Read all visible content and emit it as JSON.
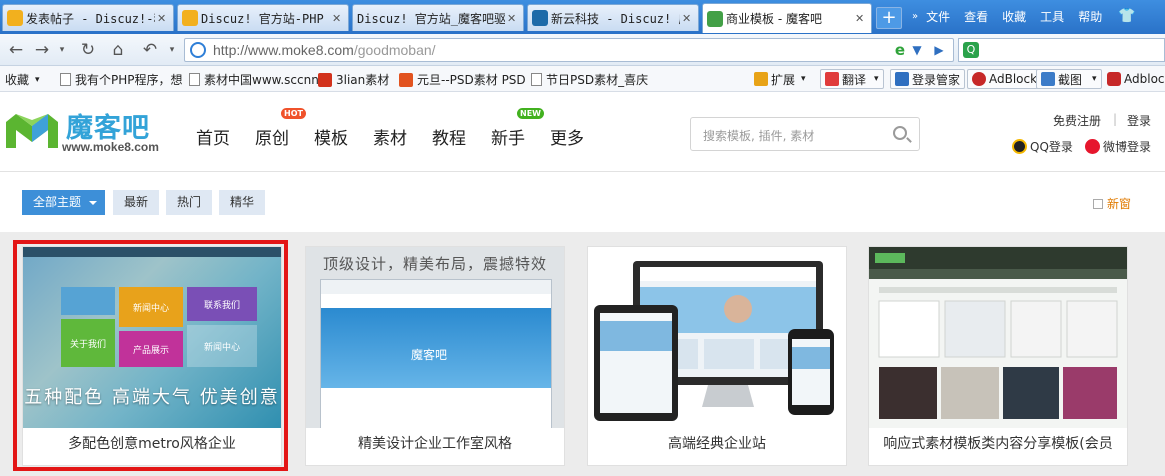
{
  "browser": {
    "tabs": [
      {
        "title": "发表帖子 - Discuz!-移",
        "close": "✕",
        "color": "#f2b01e"
      },
      {
        "title": "Discuz! 官方站-PHP 开",
        "close": "✕",
        "color": "#f2b01e"
      },
      {
        "title": "Discuz! 官方站_魔客吧驱",
        "close": "✕",
        "color": "#2b84d6"
      },
      {
        "title": "新云科技 - Discuz! 应",
        "close": "✕",
        "color": "#1d6aa8"
      },
      {
        "title": "商业模板 - 魔客吧",
        "close": "✕",
        "color": "#43a047"
      }
    ],
    "new_tab": "+",
    "menu": [
      "文件",
      "查看",
      "收藏",
      "工具",
      "帮助"
    ],
    "url_host": "http://www.moke8.com",
    "url_path": "/goodmoban/",
    "bookmarks": [
      {
        "label": "收藏",
        "icon": "chevron-down-icon"
      },
      {
        "label": "我有个PHP程序，想",
        "icon": "page-icon"
      },
      {
        "label": "素材中国www.sccnn",
        "icon": "page-icon"
      },
      {
        "label": "3lian素材",
        "icon": "3lian-icon"
      },
      {
        "label": "元旦--PSD素材 PSD",
        "icon": "psd-icon"
      },
      {
        "label": "节日PSD素材_喜庆",
        "icon": "page-icon"
      }
    ],
    "tools": {
      "extend": "扩展",
      "translate": "翻译",
      "login_manager": "登录管家",
      "adblock": "AdBlock",
      "screenshot": "截图",
      "adblock2": "Adblock"
    }
  },
  "site": {
    "logo_text": "魔客吧",
    "logo_url": "www.moke8.com",
    "nav": [
      {
        "label": "首页",
        "badge": ""
      },
      {
        "label": "原创",
        "badge": "HOT"
      },
      {
        "label": "模板",
        "badge": ""
      },
      {
        "label": "素材",
        "badge": ""
      },
      {
        "label": "教程",
        "badge": ""
      },
      {
        "label": "新手",
        "badge": "NEW"
      },
      {
        "label": "更多",
        "badge": ""
      }
    ],
    "search_placeholder": "搜索模板, 插件, 素材",
    "register": "免费注册",
    "separator": "|",
    "login": "登录",
    "qq_login": "QQ登录",
    "weibo_login": "微博登录"
  },
  "filters": {
    "all_topics": "全部主题",
    "latest": "最新",
    "popular": "热门",
    "featured": "精华",
    "new_window": "新窗"
  },
  "cards": [
    {
      "caption": "多配色创意metro风格企业",
      "thumb": {
        "slogan": "五种配色 高端大气 优美创意",
        "tiles": [
          "新闻中心",
          "联系我们",
          "关于我们",
          "产品展示",
          "新闻中心"
        ]
      }
    },
    {
      "caption": "精美设计企业工作室风格",
      "thumb": {
        "headline": "顶级设计，精美布局，震撼特效",
        "hero_text": "魔客吧"
      }
    },
    {
      "caption": "高端经典企业站",
      "thumb": {}
    },
    {
      "caption": "响应式素材模板类内容分享模板(会员",
      "thumb": {}
    }
  ],
  "colors": {
    "accent": "#3d8fd8",
    "selection": "#e31616",
    "logo": "#33a3d8",
    "new_window": "#e07a00"
  }
}
